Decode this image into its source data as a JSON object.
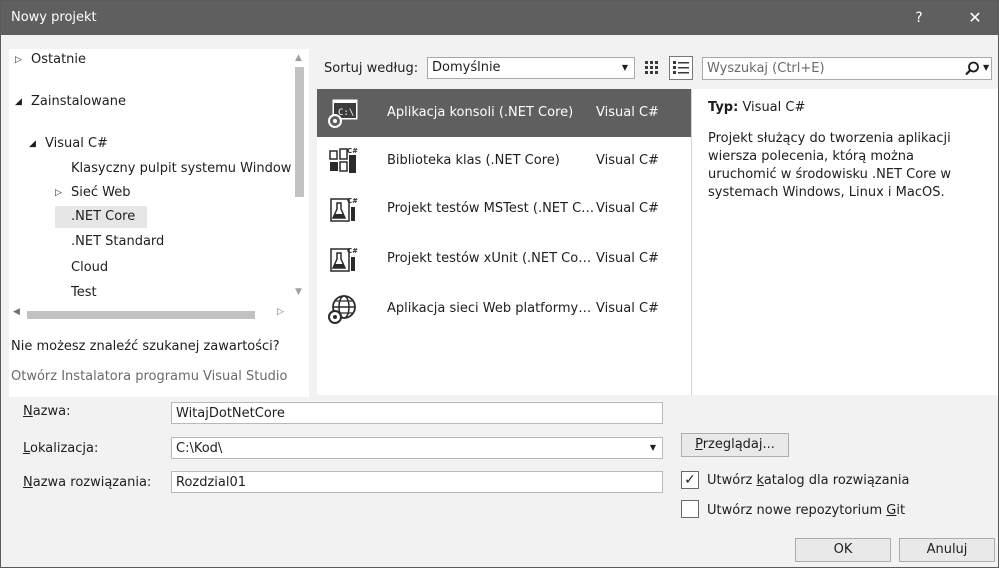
{
  "window": {
    "title": "Nowy projekt",
    "help_label": "?",
    "close_label": "✕"
  },
  "tree": {
    "items": [
      {
        "label": "Ostatnie",
        "arrow": "▷"
      },
      {
        "label": "Zainstalowane",
        "arrow": "◢"
      },
      {
        "label": "Visual C#",
        "arrow": "◢"
      },
      {
        "label": "Klasyczny pulpit systemu Windows",
        "arrow": ""
      },
      {
        "label": "Sieć Web",
        "arrow": "▷"
      },
      {
        "label": ".NET Core",
        "arrow": "",
        "selected": true
      },
      {
        "label": ".NET Standard",
        "arrow": ""
      },
      {
        "label": "Cloud",
        "arrow": ""
      },
      {
        "label": "Test",
        "arrow": ""
      }
    ]
  },
  "left_footer": {
    "not_found": "Nie możesz znaleźć szukanej zawartości?",
    "installer_link": "Otwórz Instalatora programu Visual Studio"
  },
  "toolbar": {
    "sort_label": "Sortuj według:",
    "sort_value": "Domyślnie",
    "search_placeholder": "Wyszukaj (Ctrl+E)"
  },
  "templates": [
    {
      "name": "Aplikacja konsoli (.NET Core)",
      "lang": "Visual C#",
      "icon": "console-app-icon",
      "selected": true
    },
    {
      "name": "Biblioteka klas (.NET Core)",
      "lang": "Visual C#",
      "icon": "class-library-icon"
    },
    {
      "name": "Projekt testów MSTest (.NET Core)",
      "lang": "Visual C#",
      "icon": "test-project-icon"
    },
    {
      "name": "Projekt testów xUnit (.NET Core)",
      "lang": "Visual C#",
      "icon": "test-project-icon"
    },
    {
      "name": "Aplikacja sieci Web platformy ASP.NET Core",
      "lang": "Visual C#",
      "icon": "web-app-icon"
    }
  ],
  "details": {
    "type_label": "Typ:",
    "type_value": "Visual C#",
    "description": "Projekt służący do tworzenia aplikacji wiersza polecenia, którą można uruchomić w środowisku .NET Core w systemach Windows, Linux i MacOS."
  },
  "form": {
    "name_label_key": "N",
    "name_label_rest": "azwa:",
    "name_value": "WitajDotNetCore",
    "location_label_key": "L",
    "location_label_rest": "okalizacja:",
    "location_value": "C:\\Kod\\",
    "solution_label_key": "N",
    "solution_label_rest": "azwa rozwiązania:",
    "solution_value": "Rozdzial01",
    "browse_key": "P",
    "browse_rest": "rzeglądaj...",
    "create_dir_pre": "Utwórz ",
    "create_dir_key": "k",
    "create_dir_post": "atalog dla rozwiązania",
    "create_dir_checked": true,
    "create_repo_pre": "Utwórz nowe repozytorium ",
    "create_repo_key": "G",
    "create_repo_post": "it",
    "create_repo_checked": false,
    "ok_label": "OK",
    "cancel_label": "Anuluj"
  }
}
